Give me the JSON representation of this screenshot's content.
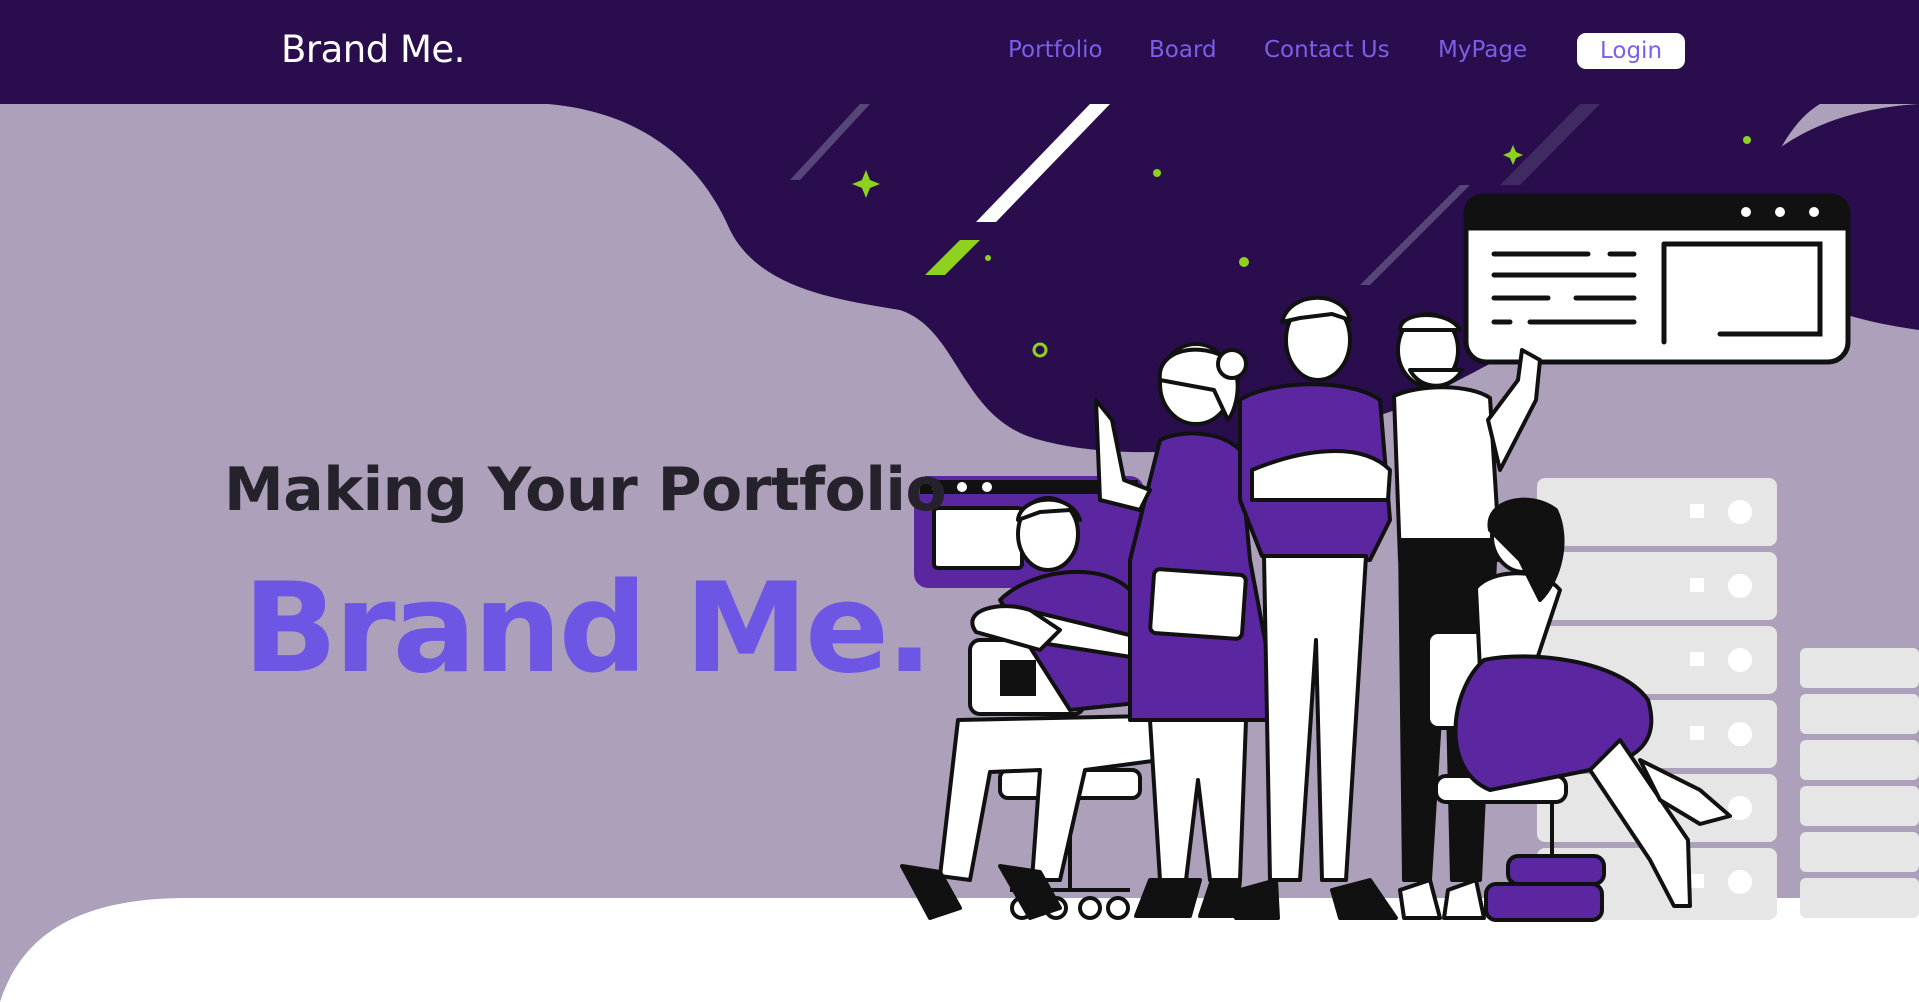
{
  "navbar": {
    "brand": "Brand Me.",
    "links": [
      {
        "label": "Portfolio"
      },
      {
        "label": "Board"
      },
      {
        "label": "Contact Us"
      },
      {
        "label": "MyPage"
      }
    ],
    "login_label": "Login"
  },
  "hero": {
    "subtitle": "Making Your Portfolio",
    "title": "Brand Me."
  },
  "colors": {
    "nav_bg": "#2a0d4c",
    "hero_bg": "#ada0ba",
    "accent": "#6e56e5",
    "illustration_purple": "#5b27a0",
    "sparkle_green": "#8fd11f"
  },
  "illustration": {
    "subject": "team-of-people-illustration"
  }
}
